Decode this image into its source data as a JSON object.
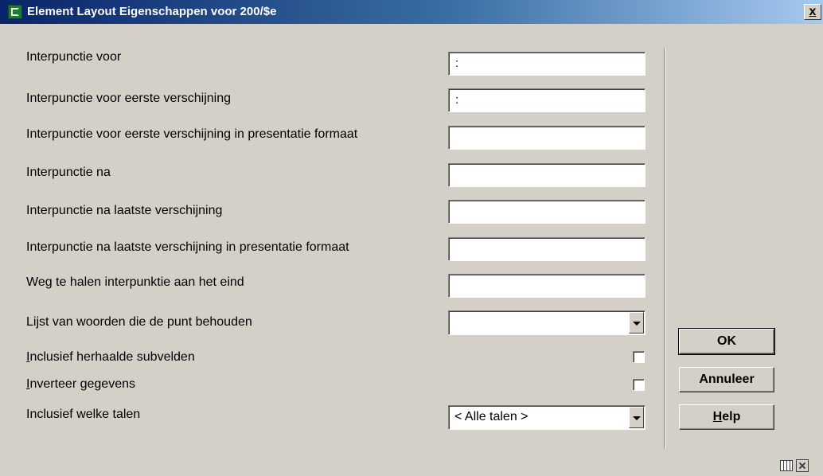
{
  "window": {
    "title": "Element Layout Eigenschappen voor 200/$e",
    "close_label": "x",
    "app_icon": "app-icon",
    "close_icon": "close-icon"
  },
  "form": {
    "fields": [
      {
        "label": "Interpunctie voor",
        "value": ":"
      },
      {
        "label": "Interpunctie voor eerste verschijning",
        "value": ":"
      },
      {
        "label": "Interpunctie voor eerste verschijning in presentatie formaat",
        "value": ""
      },
      {
        "label": "Interpunctie na",
        "value": ""
      },
      {
        "label": "Interpunctie na laatste verschijning",
        "value": ""
      },
      {
        "label": "Interpunctie na laatste verschijning in presentatie formaat",
        "value": ""
      },
      {
        "label": "Weg te halen interpunktie aan het eind",
        "value": ""
      }
    ],
    "word_list": {
      "label": "Lijst van woorden die de punt behouden",
      "value": ""
    },
    "include_repeated": {
      "accel": "I",
      "label_rest": "nclusief herhaalde subvelden",
      "checked": false
    },
    "invert_data": {
      "accel": "I",
      "label_rest": "nverteer gegevens",
      "checked": false
    },
    "languages": {
      "label": "Inclusief welke talen",
      "value": "< Alle talen >"
    }
  },
  "buttons": {
    "ok": "OK",
    "cancel": "Annuleer",
    "help_accel": "H",
    "help_rest": "elp"
  },
  "status_icons": [
    "grid-icon",
    "expand-icon"
  ],
  "colors": {
    "title_start": "#0a246a",
    "title_end": "#a6caf0",
    "window_bg": "#d4d0c8"
  }
}
